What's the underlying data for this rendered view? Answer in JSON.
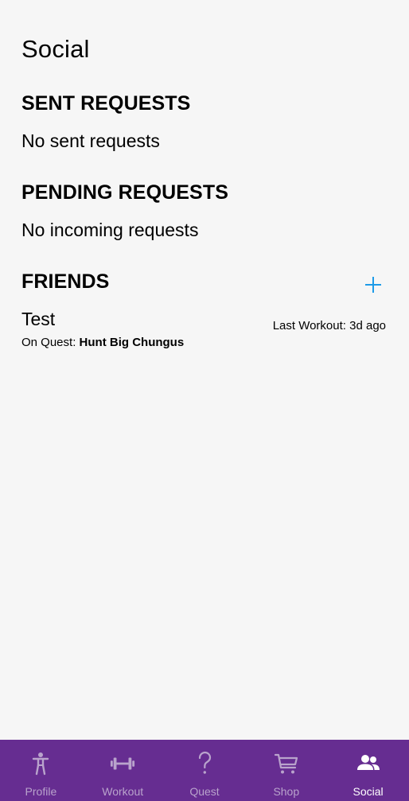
{
  "page": {
    "title": "Social"
  },
  "sections": {
    "sent": {
      "heading": "SENT REQUESTS",
      "empty_text": "No sent requests"
    },
    "pending": {
      "heading": "PENDING REQUESTS",
      "empty_text": "No incoming requests"
    },
    "friends": {
      "heading": "FRIENDS",
      "items": [
        {
          "name": "Test",
          "quest_prefix": "On Quest: ",
          "quest_name": "Hunt Big Chungus",
          "last_workout": "Last Workout: 3d ago"
        }
      ]
    }
  },
  "nav": {
    "items": [
      {
        "label": "Profile",
        "icon": "person-icon",
        "active": false
      },
      {
        "label": "Workout",
        "icon": "dumbbell-icon",
        "active": false
      },
      {
        "label": "Quest",
        "icon": "question-mark-icon",
        "active": false
      },
      {
        "label": "Shop",
        "icon": "cart-icon",
        "active": false
      },
      {
        "label": "Social",
        "icon": "people-icon",
        "active": true
      }
    ]
  },
  "colors": {
    "background": "#f6f6f6",
    "nav_background": "#662d91",
    "nav_inactive": "#b9a3cc",
    "nav_active": "#ffffff",
    "accent": "#1e9be8"
  }
}
